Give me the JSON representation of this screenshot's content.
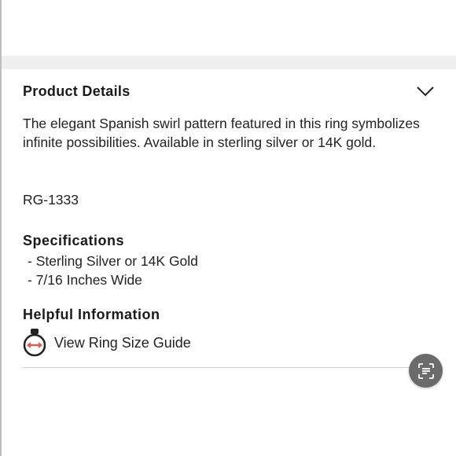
{
  "product_details": {
    "title": "Product Details",
    "description": "The elegant Spanish swirl pattern featured in this ring symbolizes infinite possibilities. Available in sterling silver or 14K gold.",
    "sku": "RG-1333"
  },
  "specifications": {
    "heading": "Specifications",
    "items": [
      "Sterling Silver or 14K Gold",
      "7/16 Inches Wide"
    ]
  },
  "helpful_information": {
    "heading": "Helpful Information",
    "size_guide_label": "View Ring Size Guide"
  },
  "icons": {
    "expand": "chevron-down-icon",
    "size_guide": "ring-size-icon",
    "scan": "scan-text-icon"
  },
  "colors": {
    "accent_red": "#e05a4f",
    "fab_bg": "#6b6b6b",
    "band_bg": "#efefef"
  }
}
